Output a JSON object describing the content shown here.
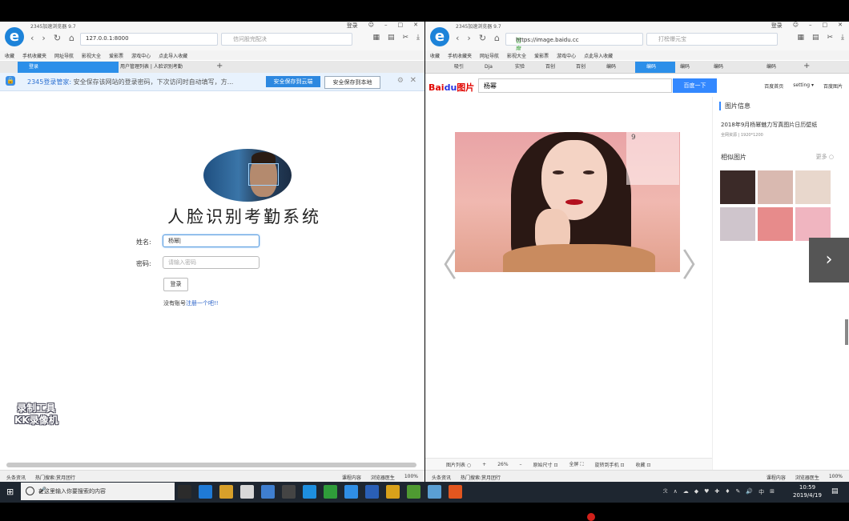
{
  "left_window": {
    "title": "2345加速浏览器 9.7",
    "window_controls": [
      "登录",
      "☺",
      "–",
      "□",
      "✕"
    ],
    "url": "127.0.0.1:8000",
    "search_placeholder": "信问股完配决",
    "favorites": [
      "收藏",
      "手机收藏夹",
      "网址导航",
      "影视大全",
      "爱影票",
      "游戏中心",
      "点此导入收藏"
    ],
    "tabs": [
      {
        "label": "登录",
        "active": true
      },
      {
        "label": "用户管理列表 | 人脸识别考勤",
        "active": false
      }
    ],
    "notice": {
      "brand": "2345登录管家:",
      "text": "安全保存该网站的登录密码，下次访问时自动填写，方...",
      "btn_cloud": "安全保存到云端",
      "btn_local": "安全保存到本地"
    },
    "form": {
      "title": "人脸识别考勤系统",
      "name_label": "姓名:",
      "name_value": "杨幂|",
      "pass_label": "密码:",
      "pass_placeholder": "请输入密码",
      "login_label": "登录",
      "register_prefix": "没有账号",
      "register_link": "注册一个吧!!"
    },
    "watermark": {
      "line1": "录制工具",
      "line2": "KK录像机"
    },
    "status": {
      "left": [
        "头条资讯",
        "热门搜索:赏月团行"
      ],
      "right": [
        "课程内容",
        "浏览器医生",
        "100%"
      ]
    }
  },
  "right_window": {
    "title": "2345加速浏览器 9.7",
    "window_controls": [
      "登录",
      "☺",
      "–",
      "□",
      "✕"
    ],
    "url_secure": "百度",
    "url": "https://image.baidu.cc",
    "search_placeholder": "打榜爆元宝",
    "favorites": [
      "收藏",
      "手机收藏夹",
      "网址导航",
      "影视大全",
      "爱影票",
      "游戏中心",
      "点此导入收藏"
    ],
    "tabs": [
      {
        "label": "吸引",
        "active": false
      },
      {
        "label": "Dja",
        "active": false
      },
      {
        "label": "实验",
        "active": false
      },
      {
        "label": "百创",
        "active": false
      },
      {
        "label": "百创",
        "active": false
      },
      {
        "label": "编码",
        "active": false
      },
      {
        "label": "编码",
        "active": true
      },
      {
        "label": "编码",
        "active": false
      },
      {
        "label": "编码",
        "active": false
      },
      {
        "label": "编码",
        "active": false
      }
    ],
    "baidu": {
      "logo_text": "Bai",
      "logo_paw": "du",
      "logo_suffix": "图片",
      "query": "杨幂",
      "search_btn": "百度一下",
      "links": [
        "百度首页",
        "setting ▾",
        "百度图片"
      ],
      "calendar_day": "9",
      "arrow_left": "〈",
      "arrow_right": "〉",
      "next_btn": "›"
    },
    "side": {
      "title": "图片信息",
      "desc": "2018年9月杨幂魅力写真图片日历壁纸",
      "sub": "全网资源 | 1920*1200",
      "similar": "相似图片",
      "more": "更多 ○"
    },
    "tools": [
      "图片列表 ○",
      "+",
      "26%",
      "–",
      "原始尺寸 ⊡",
      "全屏 ⛶",
      "旋转到手机 ⊡",
      "收藏 ⊡"
    ],
    "thumb_colors": [
      "#3b2a28",
      "#d9b9b0",
      "#e8d7cc",
      "#cfc5cc",
      "#e78b8b",
      "#f0b5c0"
    ],
    "status": {
      "left": [
        "头条资讯",
        "热门搜索:赏月团行"
      ],
      "right": [
        "课程内容",
        "浏览器医生",
        "100%"
      ]
    }
  },
  "taskbar": {
    "search_placeholder": "在这里输入你要搜索的内容",
    "app_colors": [
      "#2b2b2b",
      "#1f7ad6",
      "#d8a02a",
      "#d8d8d8",
      "#3f7fd0",
      "#444444",
      "#1e8fdf",
      "#2f9c3a",
      "#2f8ee5",
      "#2a5fb6",
      "#d9a11a",
      "#4f9a32",
      "#5a9fd4",
      "#e2561f"
    ],
    "tray": [
      "ℛ",
      "∧",
      "☁",
      "◆",
      "♥",
      "✚",
      "♦",
      "✎",
      "🔊",
      "中",
      "⊞"
    ],
    "time": "10:59",
    "date": "2019/4/19"
  }
}
